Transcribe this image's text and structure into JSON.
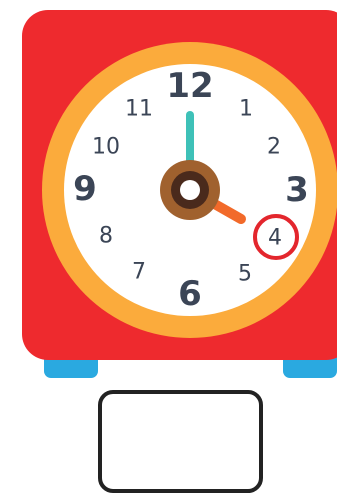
{
  "clock": {
    "numbers": {
      "n12": "12",
      "n1": "1",
      "n2": "2",
      "n3": "3",
      "n4": "4",
      "n5": "5",
      "n6": "6",
      "n7": "7",
      "n8": "8",
      "n9": "9",
      "n10": "10",
      "n11": "11"
    },
    "highlighted_number": "4",
    "time_shown": {
      "hour": 4,
      "minute": 0
    },
    "colors": {
      "body": "#ee2a2e",
      "feet": "#2aa9e0",
      "rim": "#fbab3c",
      "face": "#ffffff",
      "numerals": "#3b4556",
      "minute_hand": "#3ec1b8",
      "hour_hand": "#f26a2a",
      "hub_outer": "#a0612e",
      "hub_inner": "#4a2a1c",
      "highlight_circle": "#e3262d"
    }
  },
  "answer_box": {
    "value": ""
  }
}
